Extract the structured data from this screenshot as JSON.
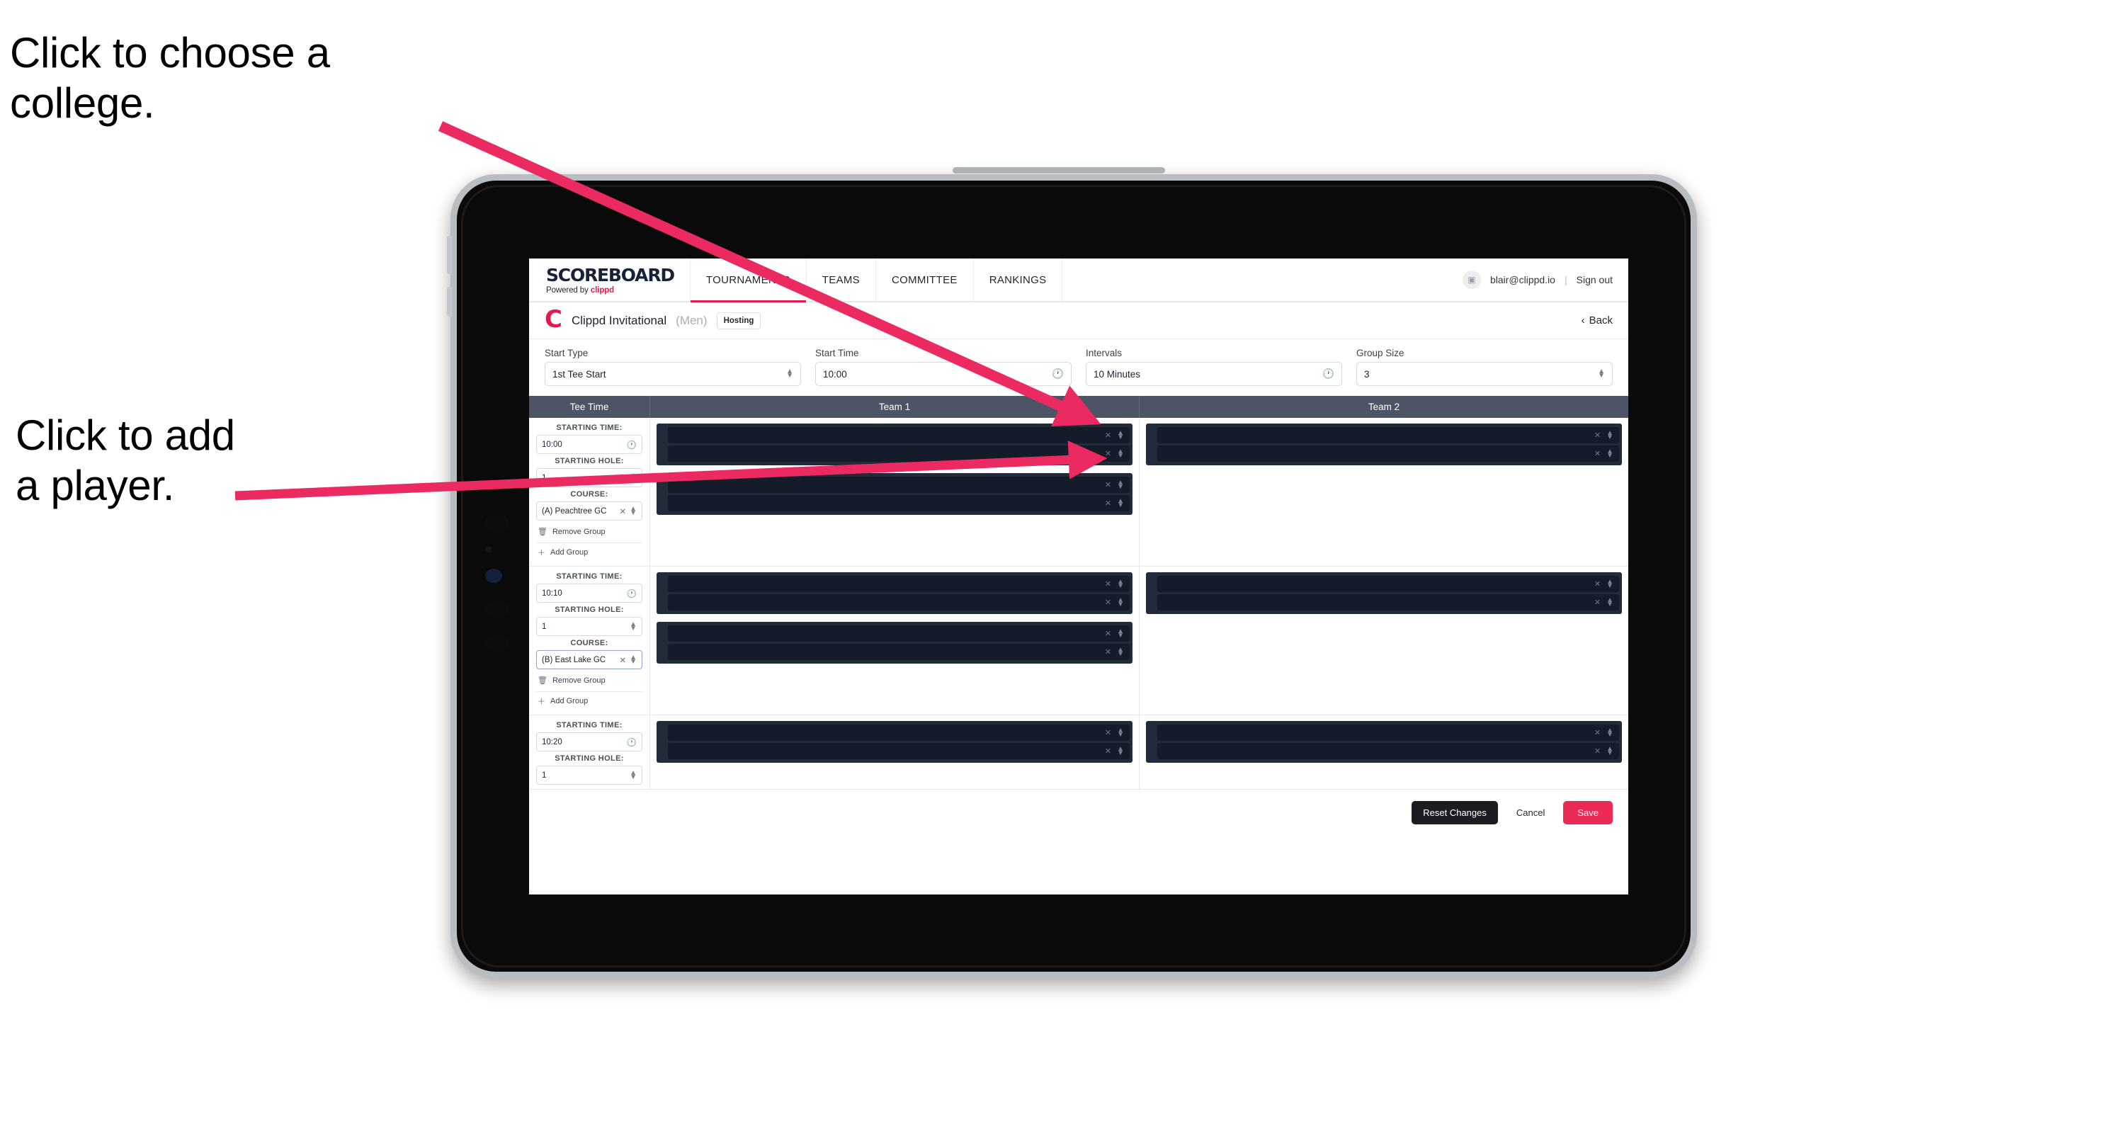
{
  "annotations": {
    "college_note": "Click to choose a\ncollege.",
    "player_note": "Click to add\na player.",
    "arrow_color": "#EC2A62"
  },
  "app": {
    "nav": {
      "brand_word": "SCOREBOARD",
      "brand_powered_prefix": "Powered by ",
      "brand_powered_name": "clippd",
      "tabs": [
        {
          "label": "TOURNAMENTS",
          "active": true
        },
        {
          "label": "TEAMS",
          "active": false
        },
        {
          "label": "COMMITTEE",
          "active": false
        },
        {
          "label": "RANKINGS",
          "active": false
        }
      ],
      "account_icon": "user-avatar-icon",
      "account_email": "blair@clippd.io",
      "separator": "|",
      "sign_out": "Sign out"
    },
    "titlebar": {
      "logo_letter": "C",
      "tournament_name": "Clippd Invitational",
      "gender": "(Men)",
      "status_badge": "Hosting",
      "back_label": "Back",
      "back_icon": "chevron-left-icon"
    },
    "filters": [
      {
        "label": "Start Type",
        "value": "1st Tee Start",
        "icon": "stepper-icon"
      },
      {
        "label": "Start Time",
        "value": "10:00",
        "icon": "clock-icon"
      },
      {
        "label": "Intervals",
        "value": "10 Minutes",
        "icon": "clock-icon"
      },
      {
        "label": "Group Size",
        "value": "3",
        "icon": "stepper-icon"
      }
    ],
    "table": {
      "headers": [
        "Tee Time",
        "Team 1",
        "Team 2"
      ],
      "field_labels": {
        "starting_time": "STARTING TIME:",
        "starting_hole": "STARTING HOLE:",
        "course": "COURSE:"
      },
      "group_actions": {
        "remove": "Remove Group",
        "remove_icon": "trash-icon",
        "add": "Add Group",
        "add_icon": "plus-icon"
      },
      "slot_icons": {
        "clear": "close-icon",
        "stepper": "stepper-icon"
      },
      "slot_placeholder": "",
      "rows": [
        {
          "starting_time": "10:00",
          "starting_hole": "1",
          "course": "(A) Peachtree GC",
          "course_focused": false,
          "team1_groups": [
            {
              "slots": 2
            },
            {
              "slots": 2
            }
          ],
          "team2_groups": [
            {
              "slots": 2
            }
          ]
        },
        {
          "starting_time": "10:10",
          "starting_hole": "1",
          "course": "(B) East Lake GC",
          "course_focused": true,
          "team1_groups": [
            {
              "slots": 2
            },
            {
              "slots": 2
            }
          ],
          "team2_groups": [
            {
              "slots": 2
            }
          ]
        },
        {
          "starting_time": "10:20",
          "starting_hole": "1",
          "course": "",
          "course_focused": false,
          "team1_groups": [
            {
              "slots": 2
            }
          ],
          "team2_groups": [
            {
              "slots": 2
            }
          ]
        }
      ]
    },
    "footer": {
      "reset": "Reset Changes",
      "cancel": "Cancel",
      "save": "Save"
    },
    "colors": {
      "accent": "#EC2A57",
      "brand_dark": "#16213A",
      "table_header": "#4D5465",
      "slot_bg": "#151C29",
      "group_bg": "#222B3A"
    }
  }
}
